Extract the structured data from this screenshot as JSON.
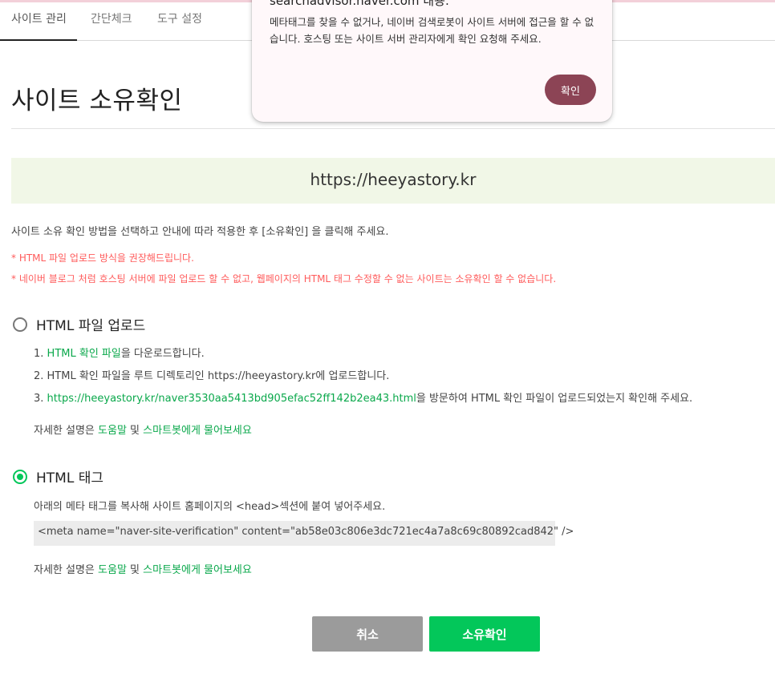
{
  "tabs": [
    {
      "label": "사이트 관리"
    },
    {
      "label": "간단체크"
    },
    {
      "label": "도구 설정"
    }
  ],
  "page_title": "사이트 소유확인",
  "site_url": "https://heeyastory.kr",
  "intro": "사이트 소유 확인 방법을 선택하고 안내에 따라 적용한 후 [소유확인] 을 클릭해 주세요.",
  "notices": [
    "* HTML 파일 업로드 방식을 권장해드립니다.",
    "* 네이버 블로그 처럼 호스팅 서버에 파일 업로드 할 수 없고, 웹페이지의 HTML 태그 수정할 수 없는 사이트는 소유확인 할 수 없습니다."
  ],
  "method_file": {
    "label": "HTML 파일 업로드",
    "selected": false,
    "step1_prefix": "1. ",
    "step1_link": "HTML 확인 파일",
    "step1_suffix": "을 다운로드합니다.",
    "step2": "2. HTML 확인 파일을 루트 디렉토리인 https://heeyastory.kr에 업로드합니다.",
    "step3_prefix": "3. ",
    "step3_link": "https://heeyastory.kr/naver3530aa5413bd905efac52ff142b2ea43.html",
    "step3_suffix": "을 방문하여 HTML 확인 파일이 업로드되었는지 확인해 주세요."
  },
  "method_tag": {
    "label": "HTML 태그",
    "selected": true,
    "instruction": "아래의 메타 태그를 복사해 사이트 홈페이지의 <head>섹션에 붙여 넣어주세요.",
    "meta_tag": "<meta name=\"naver-site-verification\" content=\"ab58e03c806e3dc721ec4a7a8c69c80892cad842\" />"
  },
  "help": {
    "prefix": "자세한 설명은 ",
    "link1": "도움말",
    "middle": " 및 ",
    "link2": "스마트봇에게 물어보세요"
  },
  "buttons": {
    "cancel": "취소",
    "confirm": "소유확인"
  },
  "dialog": {
    "title": "searchadvisor.naver.com 내용:",
    "message": "메타태그를 찾을 수 없거나, 네이버 검색로봇이 사이트 서버에 접근을 할 수 없습니다. 호스팅 또는 사이트 서버 관리자에게 확인 요청해 주세요.",
    "ok": "확인"
  },
  "colors": {
    "accent_green": "#03c75a",
    "link_green": "#0aa84b",
    "notice_red": "#ff5b5b",
    "dialog_button": "#8c4455",
    "url_box_bg": "#f1f7e7"
  }
}
